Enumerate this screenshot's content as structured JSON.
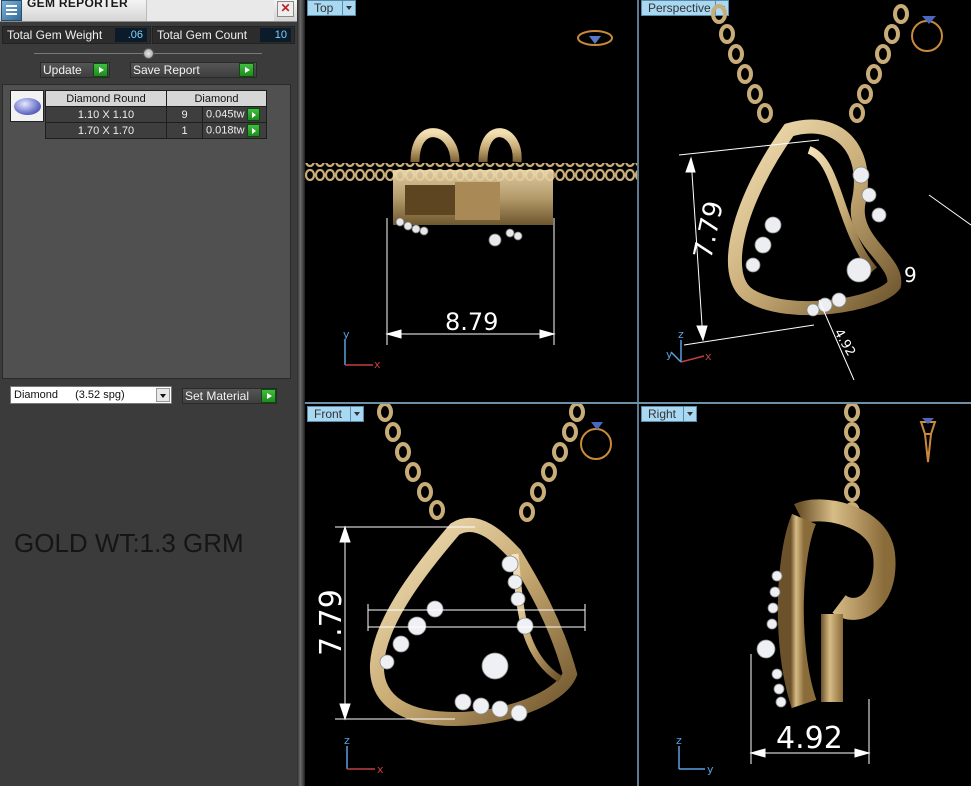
{
  "panel": {
    "title": "GEM REPORTER",
    "close_glyph": "✕",
    "total_gem_weight_label": "Total Gem Weight",
    "total_gem_weight_value": ".06",
    "total_gem_count_label": "Total Gem Count",
    "total_gem_count_value": "10",
    "update_label": "Update",
    "save_report_label": "Save Report",
    "gem_table": {
      "headers": [
        "Diamond Round",
        "Diamond"
      ],
      "rows": [
        {
          "size": "1.10 X 1.10",
          "count": "9",
          "weight": "0.045tw"
        },
        {
          "size": "1.70 X 1.70",
          "count": "1",
          "weight": "0.018tw"
        }
      ]
    },
    "material": {
      "name": "Diamond",
      "density": "(3.52 spg)"
    },
    "set_material_label": "Set Material"
  },
  "annotation": {
    "gold_weight": "GOLD WT:1.3 GRM"
  },
  "viewports": {
    "top": {
      "name": "Top",
      "dimension": "8.79",
      "axis_v": "y",
      "axis_h": "x"
    },
    "perspective": {
      "name": "Perspective",
      "dimension_main": "7.79",
      "dimension_width": "4.92",
      "dimension_side": "9",
      "axis_v": "z",
      "axis_y": "y",
      "axis_x": "x"
    },
    "front": {
      "name": "Front",
      "dimension": "7.79",
      "axis_v": "z",
      "axis_h": "x"
    },
    "right": {
      "name": "Right",
      "dimension": "4.92",
      "axis_v": "z",
      "axis_h": "y"
    }
  },
  "colors": {
    "panel_bg": "#3b3b3b",
    "viewport_bg": "#000000",
    "tab_bg": "#a9d8f2",
    "gold": "#c9ad78",
    "arrow_green": "#2fa82f",
    "value_text": "#7fd3ff"
  },
  "icons": [
    "app-icon",
    "close-icon",
    "gem-thumbnail-icon",
    "play-arrow-icon",
    "dropdown-arrow-icon",
    "ring-nav-icon",
    "pendant-nav-icon",
    "axis-gizmo-icon"
  ]
}
